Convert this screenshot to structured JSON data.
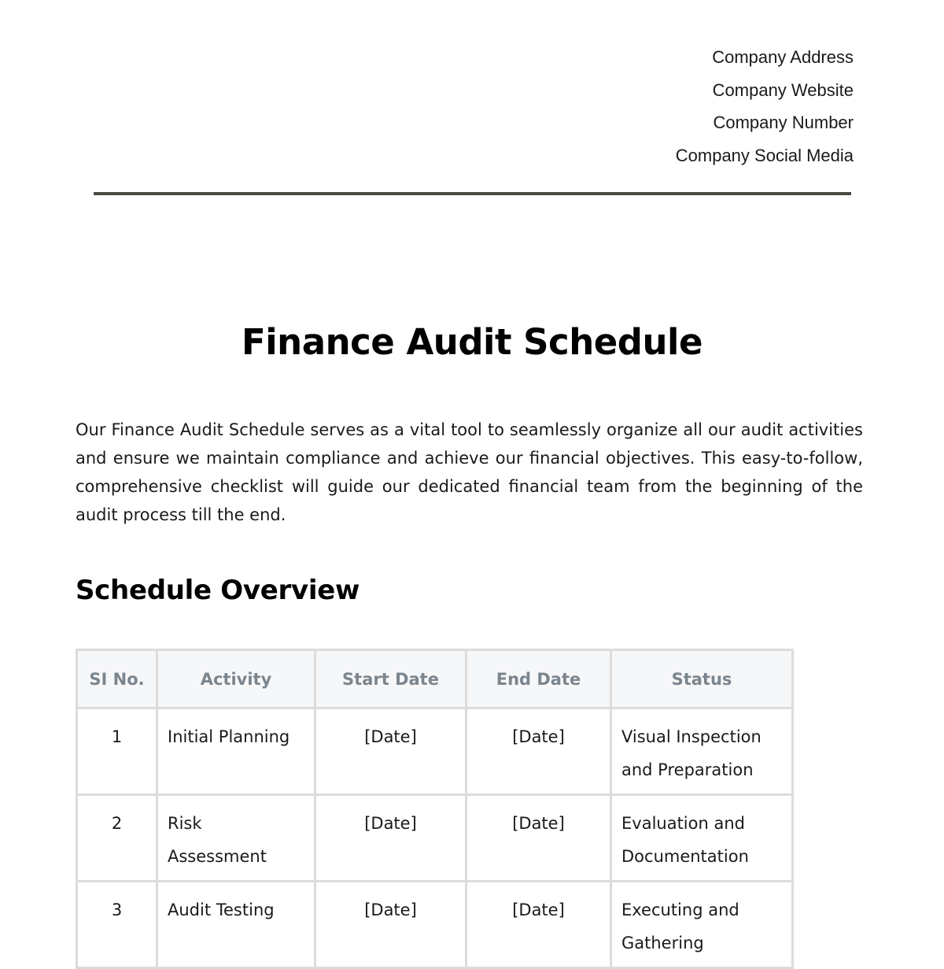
{
  "company": {
    "address": "Company Address",
    "website": "Company Website",
    "number": "Company Number",
    "social_media": "Company Social Media"
  },
  "document": {
    "title": "Finance Audit Schedule",
    "intro": "Our Finance Audit Schedule serves as a vital tool to seamlessly organize all our audit activities and ensure we maintain compliance and achieve our financial objectives. This easy-to-follow, comprehensive checklist will guide our dedicated financial team from the beginning of the audit process till the end.",
    "section_heading": "Schedule Overview"
  },
  "table": {
    "headers": [
      "SI No.",
      "Activity",
      "Start Date",
      "End Date",
      "Status"
    ],
    "rows": [
      {
        "no": "1",
        "activity": "Initial Planning",
        "start": "[Date]",
        "end": "[Date]",
        "status": "Visual Inspection and Preparation"
      },
      {
        "no": "2",
        "activity": "Risk Assessment",
        "start": "[Date]",
        "end": "[Date]",
        "status": "Evaluation and Documentation"
      },
      {
        "no": "3",
        "activity": "Audit Testing",
        "start": "[Date]",
        "end": "[Date]",
        "status": "Executing and Gathering"
      }
    ]
  },
  "colors": {
    "rule": "#4a4a40",
    "table_border": "#dcdcdc",
    "header_bg": "#f6f7f9",
    "header_text": "#7b858d"
  }
}
